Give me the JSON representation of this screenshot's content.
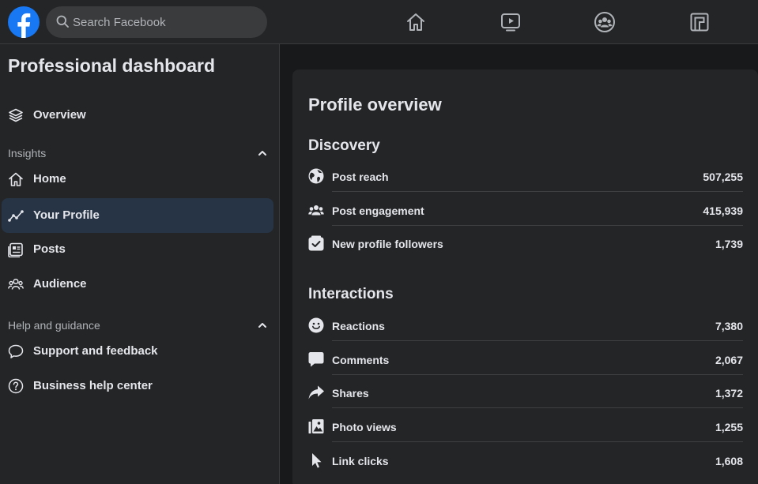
{
  "topbar": {
    "search_placeholder": "Search Facebook",
    "nav_icons": [
      "home-icon",
      "watch-icon",
      "groups-icon",
      "gaming-icon"
    ]
  },
  "sidebar": {
    "title": "Professional dashboard",
    "overview_label": "Overview",
    "insights_label": "Insights",
    "insights_items": [
      {
        "label": "Home",
        "icon": "home-outline-icon"
      },
      {
        "label": "Your Profile",
        "icon": "trend-line-icon",
        "active": true
      },
      {
        "label": "Posts",
        "icon": "posts-icon"
      },
      {
        "label": "Audience",
        "icon": "audience-icon"
      }
    ],
    "help_label": "Help and guidance",
    "help_items": [
      {
        "label": "Support and feedback",
        "icon": "speech-bubble-icon"
      },
      {
        "label": "Business help center",
        "icon": "question-circle-icon"
      }
    ]
  },
  "main": {
    "title": "Profile overview",
    "discovery": {
      "title": "Discovery",
      "rows": [
        {
          "label": "Post reach",
          "value": "507,255",
          "icon": "globe-icon"
        },
        {
          "label": "Post engagement",
          "value": "415,939",
          "icon": "people-icon"
        },
        {
          "label": "New profile followers",
          "value": "1,739",
          "icon": "follower-check-icon"
        }
      ]
    },
    "interactions": {
      "title": "Interactions",
      "rows": [
        {
          "label": "Reactions",
          "value": "7,380",
          "icon": "smiley-icon"
        },
        {
          "label": "Comments",
          "value": "2,067",
          "icon": "comment-icon"
        },
        {
          "label": "Shares",
          "value": "1,372",
          "icon": "share-arrow-icon"
        },
        {
          "label": "Photo views",
          "value": "1,255",
          "icon": "photo-icon"
        },
        {
          "label": "Link clicks",
          "value": "1,608",
          "icon": "cursor-icon"
        }
      ]
    }
  },
  "colors": {
    "page_bg": "#18191a",
    "surface": "#242526",
    "active_item": "#263445",
    "brand_blue": "#1877f2",
    "text_primary": "#e4e6eb",
    "text_secondary": "#b0b3b8"
  }
}
